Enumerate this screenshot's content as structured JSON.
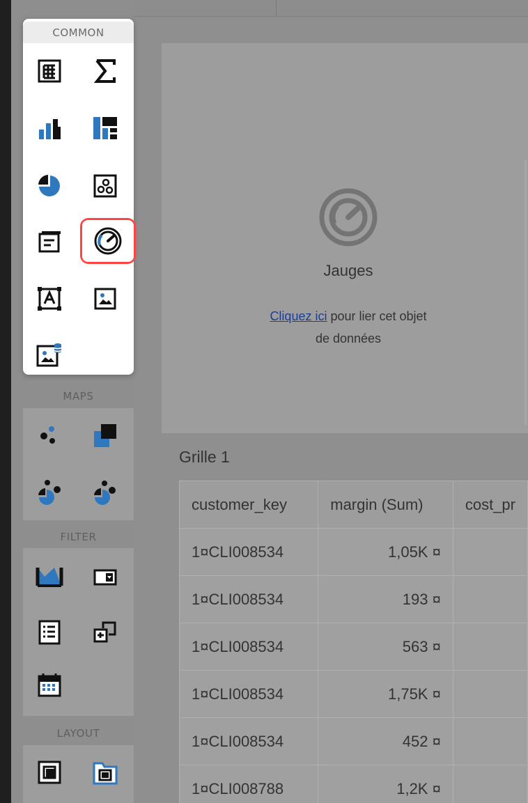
{
  "sections": {
    "common": "COMMON",
    "maps": "MAPS",
    "filter": "FILTER",
    "layout": "LAYOUT"
  },
  "tools": {
    "common": [
      {
        "icon": "grid-icon"
      },
      {
        "icon": "sigma-icon"
      },
      {
        "icon": "bar-chart-icon"
      },
      {
        "icon": "treemap-icon"
      },
      {
        "icon": "pie-chart-icon"
      },
      {
        "icon": "bubble-chart-icon"
      },
      {
        "icon": "card-icon"
      },
      {
        "icon": "gauge-icon",
        "selected": true
      },
      {
        "icon": "text-box-icon"
      },
      {
        "icon": "image-icon"
      },
      {
        "icon": "bound-image-icon"
      }
    ],
    "maps": [
      {
        "icon": "scatter-map-icon"
      },
      {
        "icon": "choropleth-map-icon"
      },
      {
        "icon": "pie-map-icon"
      },
      {
        "icon": "bubble-map-icon"
      }
    ],
    "filter": [
      {
        "icon": "range-filter-icon"
      },
      {
        "icon": "combo-box-icon"
      },
      {
        "icon": "list-box-icon"
      },
      {
        "icon": "tree-view-icon"
      },
      {
        "icon": "date-filter-icon"
      }
    ],
    "layout": [
      {
        "icon": "group-icon"
      },
      {
        "icon": "tab-container-icon"
      }
    ]
  },
  "placeholder": {
    "title": "Jauges",
    "link": "Cliquez ici",
    "text": " pour lier cet objet",
    "text2": "de données"
  },
  "grid": {
    "title": "Grille 1",
    "columns": [
      "customer_key",
      "margin (Sum)",
      "cost_pr"
    ],
    "rows": [
      [
        "1¤CLI008534",
        "1,05K ¤",
        ""
      ],
      [
        "1¤CLI008534",
        "193 ¤",
        ""
      ],
      [
        "1¤CLI008534",
        "563 ¤",
        ""
      ],
      [
        "1¤CLI008534",
        "1,75K ¤",
        ""
      ],
      [
        "1¤CLI008534",
        "452 ¤",
        ""
      ],
      [
        "1¤CLI008788",
        "1,2K ¤",
        ""
      ]
    ]
  },
  "colors": {
    "accent": "#2f78bd",
    "selection": "#ff4343",
    "toolbox_background": "#8e8e8e",
    "panel_background": "#9d9d9d"
  }
}
